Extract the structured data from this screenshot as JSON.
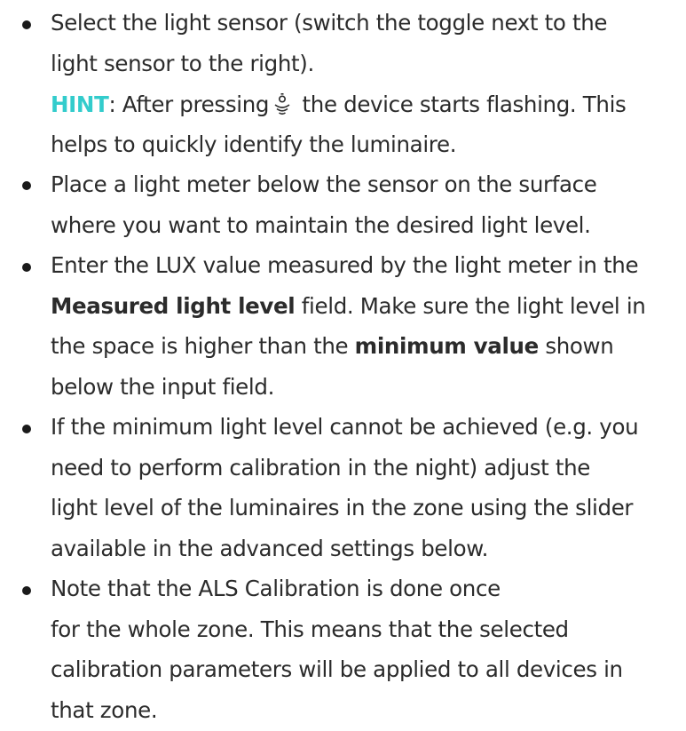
{
  "instructions": {
    "item1": {
      "text": "Select the light sensor (switch the toggle next to the light sensor to the right).",
      "line1": "Select the light sensor (switch the toggle next to the",
      "line2": "light sensor to the right).",
      "hint_label": "HINT",
      "hint_before_icon": ": After pressing",
      "hint_icon": "identify-flash-icon",
      "hint_after_icon": "the device starts flashing. This",
      "hint_line2": "helps to quickly identify the luminaire."
    },
    "item2": {
      "line1": "Place a light meter below the sensor on the surface",
      "line2": "where you want to maintain the desired light level."
    },
    "item3": {
      "line1": "Enter the LUX value measured by the light meter in the",
      "line2_bold": "Measured light level",
      "line2_rest": " field. Make sure the light level in",
      "line3_start": "the space is higher than the ",
      "line3_bold": "minimum value",
      "line3_rest": " shown",
      "line4": "below the input field."
    },
    "item4": {
      "line1": "If the minimum light level cannot be achieved (e.g. you",
      "line2": "need to perform calibration in the night) adjust the",
      "line3": "light level of the luminaires in the zone using the slider",
      "line4": "available in the advanced settings below."
    },
    "item5": {
      "line1": "Note that the ALS Calibration is done once",
      "line2": "for the whole zone. This means that the selected",
      "line3": "calibration parameters will be applied to all devices in",
      "line4": "that zone."
    }
  },
  "colors": {
    "hint": "#33cccc",
    "text": "#2b2b2b",
    "bullet": "#1a1a1a"
  }
}
